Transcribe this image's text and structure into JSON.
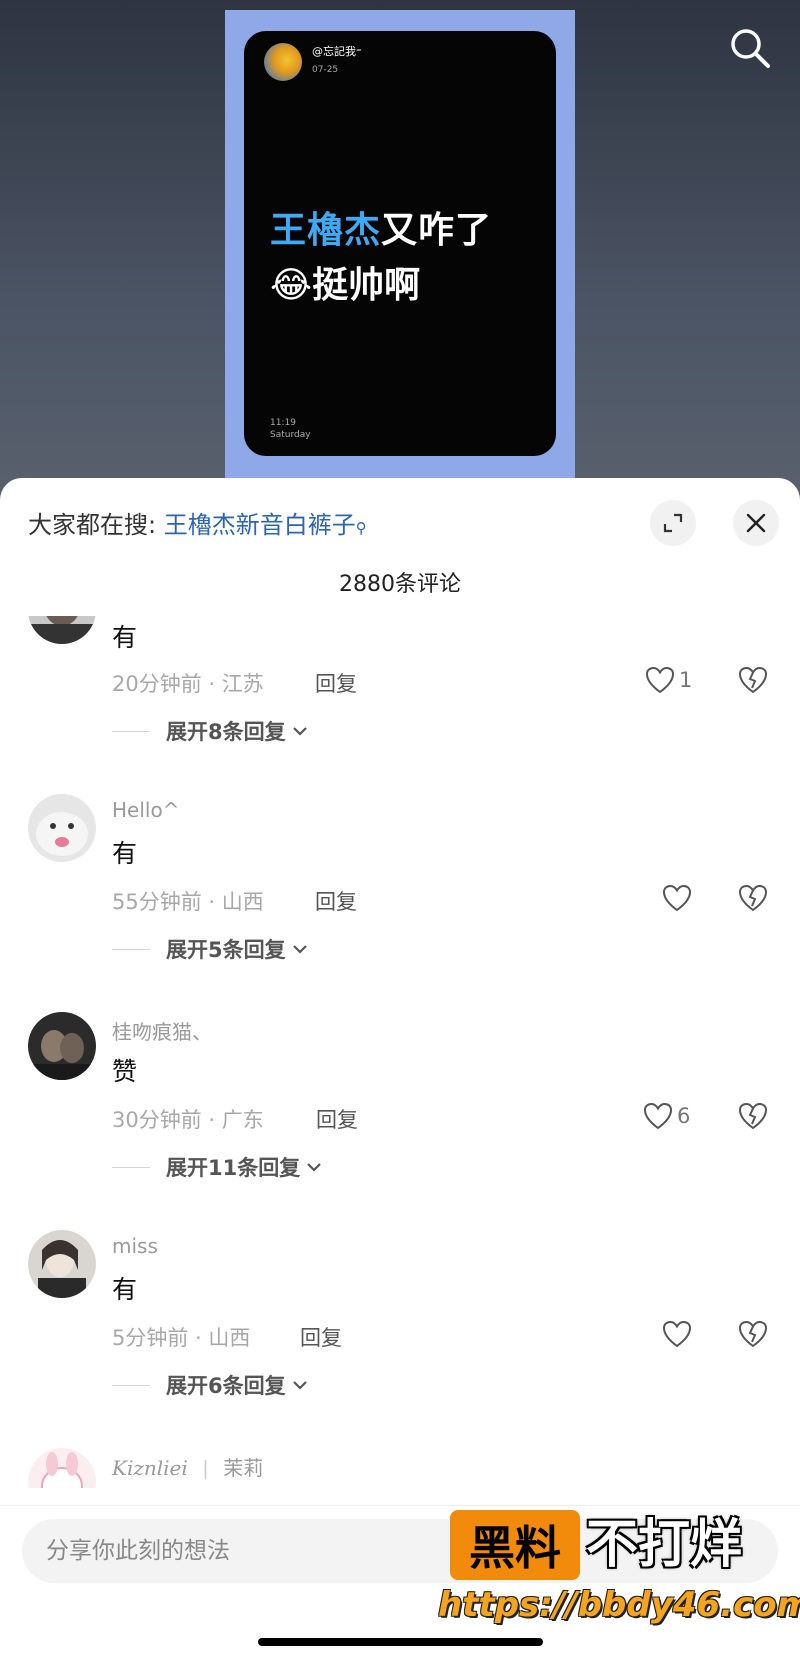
{
  "video": {
    "username": "@忘記我⁼",
    "date": "07-25",
    "line1_highlight": "王櫓杰",
    "line1_rest": "又咋了",
    "line2_emoji": "😂",
    "line2_text": "挺帅啊",
    "time": "11:19",
    "weekday": "Saturday"
  },
  "sheet": {
    "hot_search_label": "大家都在搜:",
    "hot_search_query": "王櫓杰新音白裤子",
    "comment_count": "2880条评论"
  },
  "comments": [
    {
      "username": "",
      "text": "有",
      "time_location": "20分钟前 · 江苏",
      "reply_label": "回复",
      "likes": "1",
      "expand_label": "展开8条回复"
    },
    {
      "username": "Hello^",
      "text": "有",
      "time_location": "55分钟前 · 山西",
      "reply_label": "回复",
      "likes": "",
      "expand_label": "展开5条回复"
    },
    {
      "username": "桂吻痕猫、",
      "text": "赞",
      "time_location": "30分钟前 · 广东",
      "reply_label": "回复",
      "likes": "6",
      "expand_label": "展开11条回复"
    },
    {
      "username": "miss",
      "text": "有",
      "time_location": "5分钟前 · 山西",
      "reply_label": "回复",
      "likes": "",
      "expand_label": "展开6条回复"
    },
    {
      "username": "Kiznliei",
      "username_extra": "茉莉"
    }
  ],
  "composer": {
    "placeholder": "分享你此刻的想法"
  },
  "watermark": {
    "badge": "黑料",
    "text": "不打烊",
    "url": "https://bbdy46.com"
  },
  "icons": [
    "search-icon",
    "expand-icon",
    "close-icon",
    "heart-icon",
    "broken-heart-icon",
    "chevron-down-icon"
  ],
  "colors": {
    "link": "#2d64b3",
    "cover_frame": "#8ea8e8",
    "highlight": "#3fa9f5",
    "watermark_orange": "#f28a0c"
  }
}
